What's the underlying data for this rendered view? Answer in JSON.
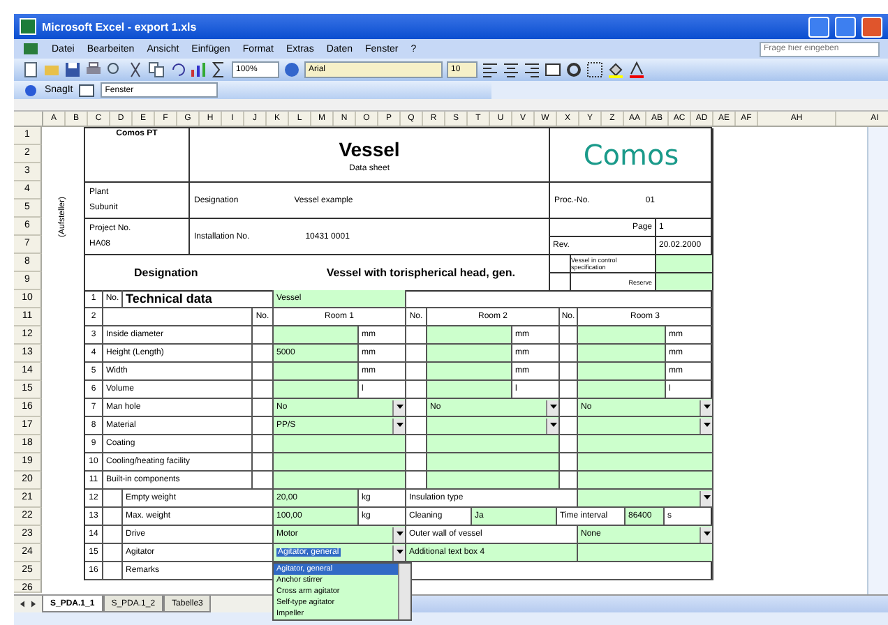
{
  "window": {
    "title": "Microsoft Excel - export 1.xls"
  },
  "menu": [
    "Datei",
    "Bearbeiten",
    "Ansicht",
    "Einfügen",
    "Format",
    "Extras",
    "Daten",
    "Fenster",
    "?"
  ],
  "help_box": {
    "placeholder": "Frage hier eingeben"
  },
  "toolbar": {
    "zoom": "100%",
    "font": "Arial",
    "size": "10"
  },
  "toolbar2": {
    "snagit": "SnagIt",
    "window": "Fenster"
  },
  "columns": [
    "A",
    "B",
    "C",
    "D",
    "E",
    "F",
    "G",
    "H",
    "I",
    "J",
    "K",
    "L",
    "M",
    "N",
    "O",
    "P",
    "Q",
    "R",
    "S",
    "T",
    "U",
    "V",
    "W",
    "X",
    "Y",
    "Z",
    "AA",
    "AB",
    "AC",
    "AD",
    "AE",
    "AF",
    "AH",
    "AI"
  ],
  "rows": [
    "1",
    "2",
    "3",
    "4",
    "5",
    "6",
    "7",
    "8",
    "9",
    "10",
    "11",
    "12",
    "13",
    "14",
    "15",
    "16",
    "17",
    "18",
    "19",
    "20",
    "21",
    "22",
    "23",
    "24",
    "25",
    "26"
  ],
  "side_label": "(Aufsteller)",
  "header": {
    "company": "Comos PT",
    "title": "Vessel",
    "subtitle": "Data sheet",
    "logo": "Comos",
    "plant_label": "Plant",
    "unit_label": "Subunit",
    "designation_label": "Designation",
    "designation_value": "Vessel example",
    "proc_label": "Proc.-No.",
    "proc_value": "01",
    "project_label": "Project No.",
    "project_value": "HA08",
    "installation_label": "Installation No.",
    "installation_value": "10431 0001",
    "page_label": "Page",
    "page_value": "1",
    "rev_label": "Rev.",
    "rev_date": "20.02.2000",
    "main_label": "Designation",
    "main_value": "Vessel with torispherical head, gen.",
    "control_label": "Vessel in control specification",
    "reserve_label": "Reserve"
  },
  "form": [
    {
      "kind": "section",
      "number": "1",
      "no": "No.",
      "title": "Technical data",
      "value": "Vessel"
    },
    {
      "kind": "rooms",
      "number": "2",
      "no_labels": [
        "No.",
        "No.",
        "No."
      ],
      "rooms": [
        "Room 1",
        "Room 2",
        "Room 3"
      ]
    },
    {
      "kind": "measure",
      "number": "3",
      "label": "Inside diameter",
      "cells": [
        {
          "unit": "mm"
        },
        {
          "unit": "mm"
        },
        {
          "unit": "mm"
        }
      ]
    },
    {
      "kind": "measure",
      "number": "4",
      "label": "Height (Length)",
      "cells": [
        {
          "value": "5000",
          "unit": "mm"
        },
        {
          "unit": "mm"
        },
        {
          "unit": "mm"
        }
      ]
    },
    {
      "kind": "measure",
      "number": "5",
      "label": "Width",
      "cells": [
        {
          "unit": "mm"
        },
        {
          "unit": "mm"
        },
        {
          "unit": "mm"
        }
      ]
    },
    {
      "kind": "measure",
      "number": "6",
      "label": "Volume",
      "cells": [
        {
          "unit": "l"
        },
        {
          "unit": "l"
        },
        {
          "unit": "l"
        }
      ]
    },
    {
      "kind": "select",
      "number": "7",
      "label": "Man hole",
      "cells": [
        {
          "value": "No"
        },
        {
          "value": "No"
        },
        {
          "value": "No"
        }
      ]
    },
    {
      "kind": "select",
      "number": "8",
      "label": "Material",
      "cells": [
        {
          "value": "PP/S"
        },
        {},
        {}
      ]
    },
    {
      "kind": "fill",
      "number": "9",
      "label": "Coating"
    },
    {
      "kind": "fill",
      "number": "10",
      "label": "Cooling/heating facility"
    },
    {
      "kind": "fill",
      "number": "11",
      "label": "Built-in components"
    },
    {
      "kind": "extra",
      "number": "12",
      "label": "Empty weight",
      "main": {
        "kind": "input",
        "value": "20,00",
        "unit": "kg"
      },
      "right": [
        {
          "kind": "label",
          "text": "Insulation type"
        },
        {
          "kind": "select"
        }
      ]
    },
    {
      "kind": "extra",
      "number": "13",
      "label": "Max. weight",
      "main": {
        "kind": "input",
        "value": "100,00",
        "unit": "kg"
      },
      "right": [
        {
          "kind": "label",
          "text": "Cleaning"
        },
        {
          "kind": "input",
          "text": "Ja"
        },
        {
          "kind": "label",
          "text": "Time interval"
        },
        {
          "kind": "input",
          "text": "86400"
        },
        {
          "kind": "label",
          "text": "s"
        }
      ]
    },
    {
      "kind": "extra",
      "number": "14",
      "label": "Drive",
      "main": {
        "kind": "select",
        "value": "Motor"
      },
      "right": [
        {
          "kind": "label",
          "text": "Outer wall of vessel"
        },
        {
          "kind": "select",
          "text": "None"
        }
      ]
    },
    {
      "kind": "extra",
      "number": "15",
      "label": "Agitator",
      "main": {
        "kind": "select",
        "value": "Agitator, general",
        "selected": true
      },
      "right": [
        {
          "kind": "input",
          "text": "Additional text box 4"
        },
        {
          "kind": "input"
        }
      ]
    },
    {
      "kind": "extra",
      "number": "16",
      "label": "Remarks"
    }
  ],
  "dropdown": [
    {
      "text": "Agitator, general",
      "selected": true
    },
    {
      "text": "Anchor stirrer",
      "selected": false
    },
    {
      "text": "Cross arm agitator",
      "selected": false
    },
    {
      "text": "Self-type agitator",
      "selected": false
    },
    {
      "text": "Impeller",
      "selected": false
    }
  ],
  "sheet_tabs": [
    {
      "label": "S_PDA.1_1",
      "selected": true
    },
    {
      "label": "S_PDA.1_2",
      "selected": false
    },
    {
      "label": "Tabelle3",
      "selected": false
    }
  ]
}
